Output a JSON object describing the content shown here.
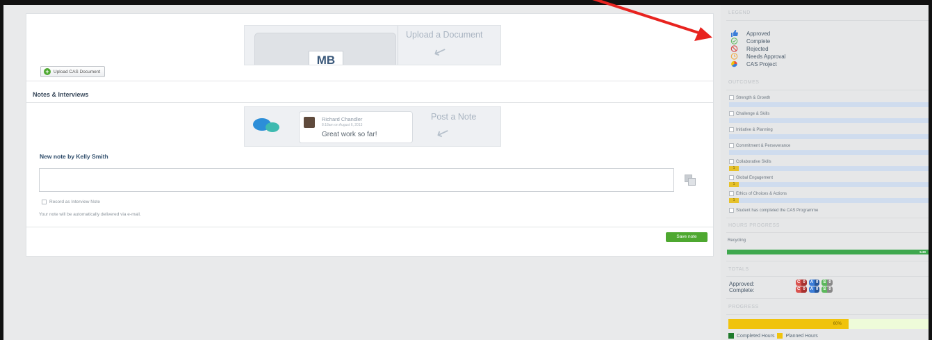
{
  "upload": {
    "caption": "Upload a Document",
    "logo_text": "MB",
    "button_label": "Upload CAS Document",
    "button_icon": "plus-circle-icon"
  },
  "notes": {
    "section_title": "Notes & Interviews",
    "sample": {
      "author": "Richard Chandler",
      "date": "8:18am on August 6, 2013",
      "message": "Great work so far!",
      "caption": "Post a Note"
    },
    "new_note_title": "New note by Kelly Smith",
    "textarea_value": "",
    "record_label": "Record as Interview Note",
    "email_notice": "Your note will be automatically delivered via e-mail.",
    "save_label": "Save note"
  },
  "sidebar": {
    "legend_title": "LEGEND",
    "legend": [
      {
        "label": "Approved",
        "icon": "thumbs-up-icon",
        "color": "#3b7dd8"
      },
      {
        "label": "Complete",
        "icon": "check-circle-icon",
        "color": "#5cb85c"
      },
      {
        "label": "Rejected",
        "icon": "no-entry-icon",
        "color": "#d9534f"
      },
      {
        "label": "Needs Approval",
        "icon": "clock-icon",
        "color": "#f0ad4e"
      },
      {
        "label": "CAS Project",
        "icon": "cas-project-icon",
        "color": "#e74c3c"
      }
    ],
    "outcomes_title": "OUTCOMES",
    "outcomes": [
      {
        "label": "Strength & Growth",
        "count": ""
      },
      {
        "label": "Challenge & Skills",
        "count": ""
      },
      {
        "label": "Initiative & Planning",
        "count": ""
      },
      {
        "label": "Commitment & Perseverance",
        "count": ""
      },
      {
        "label": "Collaborative Skills",
        "count": "1"
      },
      {
        "label": "Global Engagement",
        "count": "1"
      },
      {
        "label": "Ethics of Choices & Actions",
        "count": "1"
      }
    ],
    "completion_label": "Student has completed the CAS Programme",
    "hours_title": "HOURS PROGRESS",
    "hours": {
      "label": "Recycling",
      "value": "5.30"
    },
    "totals_title": "TOTALS",
    "totals": [
      {
        "label": "Approved:",
        "badges": [
          [
            "C",
            "0"
          ],
          [
            "A",
            "0"
          ],
          [
            "S",
            "0"
          ]
        ]
      },
      {
        "label": "Complete:",
        "badges": [
          [
            "C",
            "0"
          ],
          [
            "A",
            "0"
          ],
          [
            "S",
            "0"
          ]
        ]
      }
    ],
    "progress_title": "PROGRESS",
    "progress": {
      "percent_label": "60%",
      "value": 0.6
    },
    "progress_legend": {
      "completed": "Completed Hours",
      "planned": "Planned Hours"
    }
  },
  "colors": {
    "accent_green": "#4ea830",
    "progress_yellow": "#f0c30c",
    "completed_green": "#1f7a2c",
    "annotation_red": "#e8231f"
  }
}
